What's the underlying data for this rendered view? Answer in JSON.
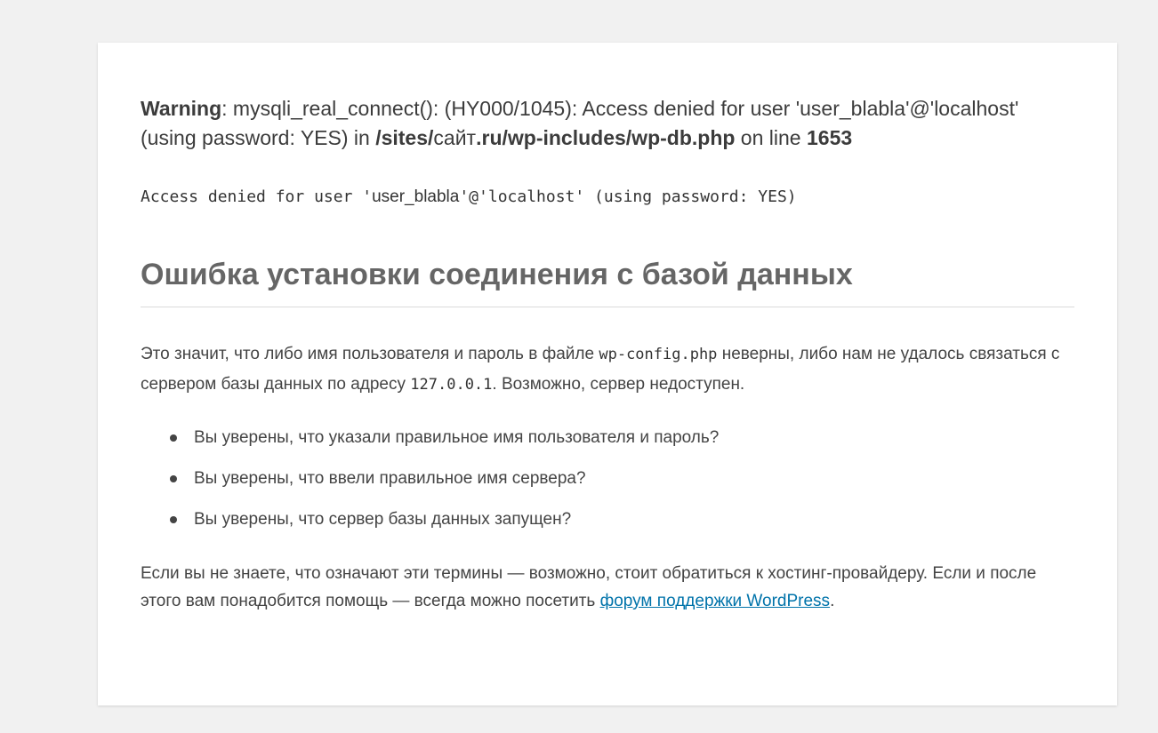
{
  "warning": {
    "label": "Warning",
    "text1": ": mysqli_real_connect(): (HY000/1045): Access denied for user '",
    "user": "user_blabla",
    "text2": "'@'localhost' (using password: YES) in ",
    "path_a": "/sites/",
    "site": "сайт",
    "path_b": ".ru/wp-includes/wp-db.php",
    "text3": " on line ",
    "line": "1653"
  },
  "mono": {
    "prefix": "Access denied for user '",
    "user": "user_blabla",
    "suffix": "'@'localhost' (using password: YES)"
  },
  "heading": "Ошибка установки соединения с базой данных",
  "para1": {
    "t1": "Это значит, что либо имя пользователя и пароль в файле ",
    "code1": "wp-config.php",
    "t2": " неверны, либо нам не удалось связаться с сервером базы данных по адресу ",
    "code2": "127.0.0.1",
    "t3": ". Возможно, сервер недоступен."
  },
  "list": [
    "Вы уверены, что указали правильное имя пользователя и пароль?",
    "Вы уверены, что ввели правильное имя сервера?",
    "Вы уверены, что сервер базы данных запущен?"
  ],
  "para2": {
    "t1": "Если вы не знаете, что означают эти термины — возможно, стоит обратиться к хостинг-провайдеру. Если и после этого вам понадобится помощь — всегда можно посетить ",
    "link": "форум поддержки WordPress",
    "t2": "."
  },
  "colors": {
    "background": "#f1f1f1",
    "panel": "#ffffff",
    "link": "#0073aa",
    "heading": "#666666"
  }
}
